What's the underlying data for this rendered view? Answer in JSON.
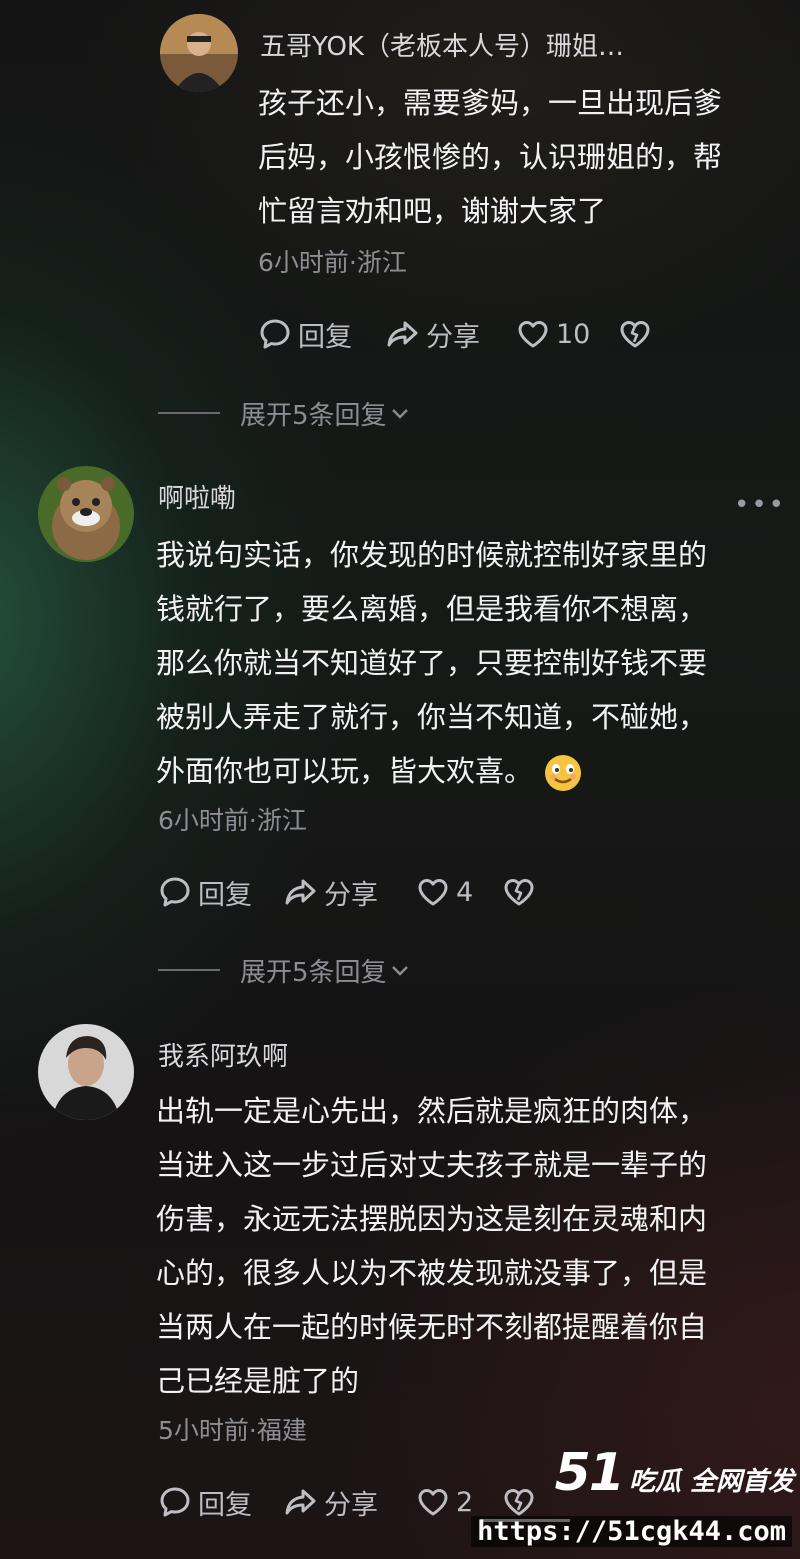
{
  "comments": [
    {
      "username": "五哥YOK（老板本人号）珊姐…",
      "lines": [
        "孩子还小，需要爹妈，一旦出现后爹",
        "后妈，小孩恨惨的，认识珊姐的，帮",
        "忙留言劝和吧，谢谢大家了"
      ],
      "meta": "6小时前·浙江",
      "reply_label": "回复",
      "share_label": "分享",
      "likes": "10",
      "expand_label": "展开5条回复"
    },
    {
      "username": "啊啦嘞",
      "lines": [
        "我说句实话，你发现的时候就控制好家里的",
        "钱就行了，要么离婚，但是我看你不想离，",
        "那么你就当不知道好了，只要控制好钱不要",
        "被别人弄走了就行，你当不知道，不碰她，",
        "外面你也可以玩，皆大欢喜。"
      ],
      "meta": "6小时前·浙江",
      "reply_label": "回复",
      "share_label": "分享",
      "likes": "4",
      "expand_label": "展开5条回复",
      "more_label": "•••"
    },
    {
      "username": "我系阿玖啊",
      "lines": [
        "出轨一定是心先出，然后就是疯狂的肉体，",
        "当进入这一步过后对丈夫孩子就是一辈子的",
        "伤害，永远无法摆脱因为这是刻在灵魂和内",
        "心的，很多人以为不被发现就没事了，但是",
        "当两人在一起的时候无时不刻都提醒着你自",
        "己已经是脏了的"
      ],
      "meta": "5小时前·福建",
      "reply_label": "回复",
      "share_label": "分享",
      "likes": "2"
    }
  ],
  "watermark": {
    "number": "51",
    "text": "吃瓜 全网首发",
    "url": "https://51cgk44.com"
  },
  "icons": {
    "reply": "comment-bubble-icon",
    "share": "share-arrow-icon",
    "like": "heart-icon",
    "dislike": "broken-heart-icon",
    "expand": "chevron-down-icon",
    "emoji": "smile-emoji-icon"
  }
}
